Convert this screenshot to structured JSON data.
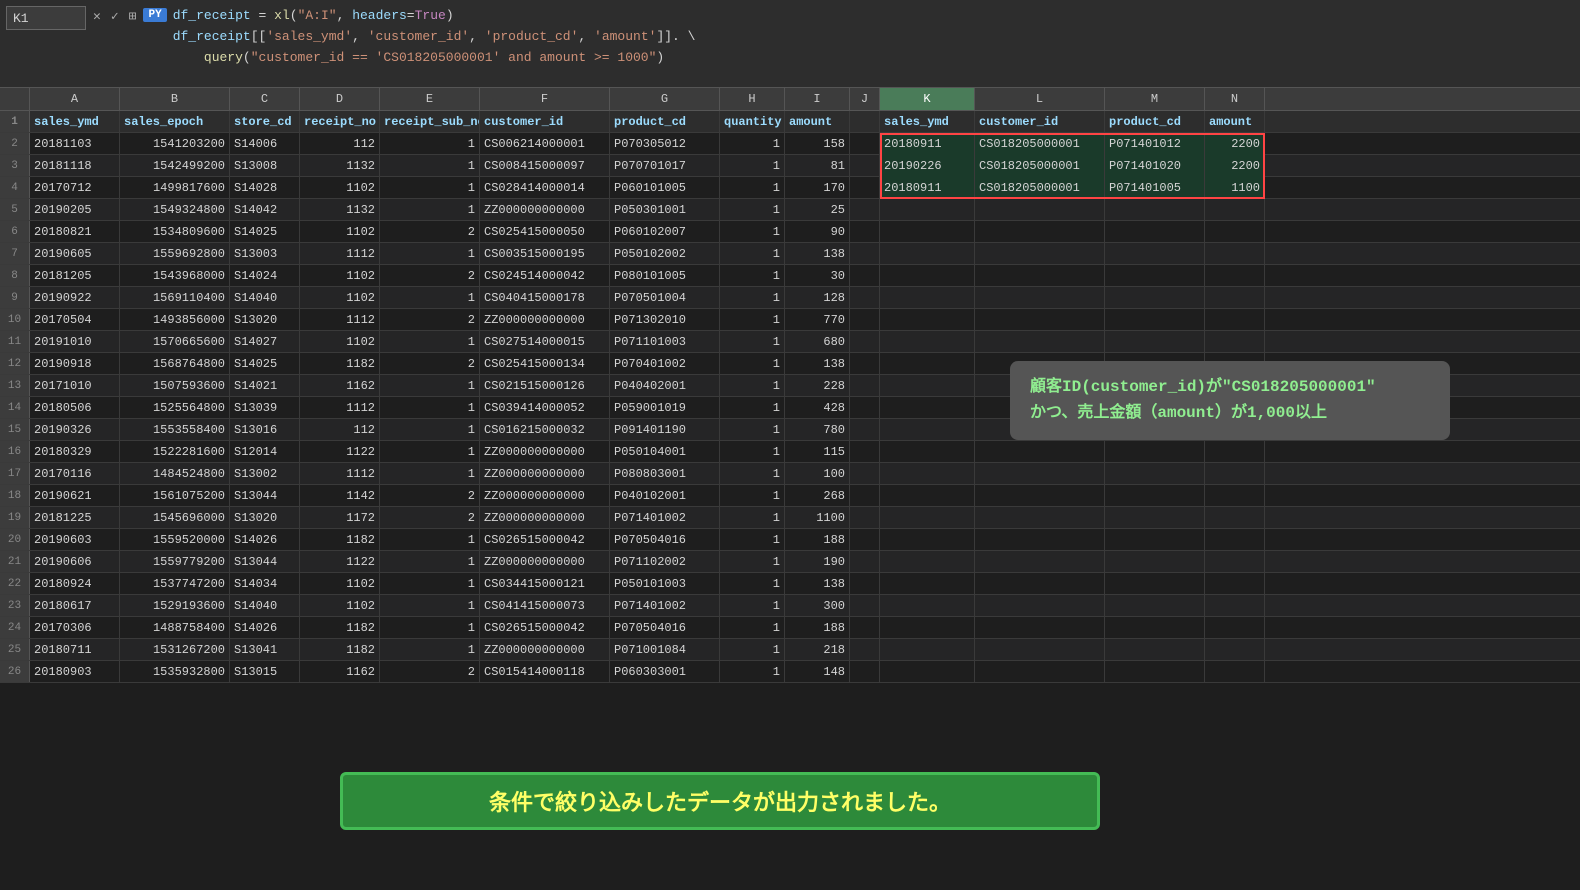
{
  "formula_bar": {
    "cell_ref": "K1",
    "py_badge": "PY",
    "line1": "df_receipt = xl(\"A:I\", headers=True)",
    "line2": "df_receipt[['sales_ymd', 'customer_id', 'product_cd', 'amount']].",
    "line3": "query(\"customer_id == 'CS018205000001' and amount >= 1000\")"
  },
  "columns": {
    "row_header": "",
    "cols": [
      "A",
      "B",
      "C",
      "D",
      "E",
      "F",
      "G",
      "H",
      "I",
      "J",
      "K",
      "L",
      "M",
      "N"
    ]
  },
  "header_row": {
    "row_num": "1",
    "cells": [
      "sales_ymd",
      "sales_epoch",
      "store_cd",
      "receipt_no",
      "receipt_sub_no",
      "customer_id",
      "product_cd",
      "quantity",
      "amount",
      "",
      "sales_ymd",
      "customer_id",
      "product_cd",
      "amount"
    ]
  },
  "data_rows": [
    {
      "n": "2200",
      "a": "20181103",
      "b": "1541203200",
      "c": "S14006",
      "d": "112",
      "e": "1",
      "f": "CS006214000001",
      "g": "P070305012",
      "h": "1",
      "i": "158",
      "j": "",
      "k": "20180911",
      "l": "CS018205000001",
      "m": "P071401012"
    },
    {
      "n": "2200",
      "a": "20181118",
      "b": "1542499200",
      "c": "S13008",
      "d": "1132",
      "e": "1",
      "f": "CS008415000097",
      "g": "P070701017",
      "h": "1",
      "i": "81",
      "j": "",
      "k": "20190226",
      "l": "CS018205000001",
      "m": "P071401020"
    },
    {
      "n": "1100",
      "a": "20170712",
      "b": "1499817600",
      "c": "S14028",
      "d": "1102",
      "e": "1",
      "f": "CS028414000014",
      "g": "P060101005",
      "h": "1",
      "i": "170",
      "j": "",
      "k": "20180911",
      "l": "CS018205000001",
      "m": "P071401005"
    },
    {
      "n": "",
      "a": "20190205",
      "b": "1549324800",
      "c": "S14042",
      "d": "1132",
      "e": "1",
      "f": "ZZ000000000000",
      "g": "P050301001",
      "h": "1",
      "i": "25",
      "j": "",
      "k": "",
      "l": "",
      "m": ""
    },
    {
      "n": "",
      "a": "20180821",
      "b": "1534809600",
      "c": "S14025",
      "d": "1102",
      "e": "2",
      "f": "CS025415000050",
      "g": "P060102007",
      "h": "1",
      "i": "90",
      "j": "",
      "k": "",
      "l": "",
      "m": ""
    },
    {
      "n": "",
      "a": "20190605",
      "b": "1559692800",
      "c": "S13003",
      "d": "1112",
      "e": "1",
      "f": "CS003515000195",
      "g": "P050102002",
      "h": "1",
      "i": "138",
      "j": "",
      "k": "",
      "l": "",
      "m": ""
    },
    {
      "n": "",
      "a": "20181205",
      "b": "1543968000",
      "c": "S14024",
      "d": "1102",
      "e": "2",
      "f": "CS024514000042",
      "g": "P080101005",
      "h": "1",
      "i": "30",
      "j": "",
      "k": "",
      "l": "",
      "m": ""
    },
    {
      "n": "",
      "a": "20190922",
      "b": "1569110400",
      "c": "S14040",
      "d": "1102",
      "e": "1",
      "f": "CS040415000178",
      "g": "P070501004",
      "h": "1",
      "i": "128",
      "j": "",
      "k": "",
      "l": "",
      "m": ""
    },
    {
      "n": "",
      "a": "20170504",
      "b": "1493856000",
      "c": "S13020",
      "d": "1112",
      "e": "2",
      "f": "ZZ000000000000",
      "g": "P071302010",
      "h": "1",
      "i": "770",
      "j": "",
      "k": "",
      "l": "",
      "m": ""
    },
    {
      "n": "",
      "a": "20191010",
      "b": "1570665600",
      "c": "S14027",
      "d": "1102",
      "e": "1",
      "f": "CS027514000015",
      "g": "P071101003",
      "h": "1",
      "i": "680",
      "j": "",
      "k": "",
      "l": "",
      "m": ""
    },
    {
      "n": "",
      "a": "20190918",
      "b": "1568764800",
      "c": "S14025",
      "d": "1182",
      "e": "2",
      "f": "CS025415000134",
      "g": "P070401002",
      "h": "1",
      "i": "138",
      "j": "",
      "k": "",
      "l": "",
      "m": ""
    },
    {
      "n": "",
      "a": "20171010",
      "b": "1507593600",
      "c": "S14021",
      "d": "1162",
      "e": "1",
      "f": "CS021515000126",
      "g": "P040402001",
      "h": "1",
      "i": "228",
      "j": "",
      "k": "",
      "l": "",
      "m": ""
    },
    {
      "n": "",
      "a": "20180506",
      "b": "1525564800",
      "c": "S13039",
      "d": "1112",
      "e": "1",
      "f": "CS039414000052",
      "g": "P059001019",
      "h": "1",
      "i": "428",
      "j": "",
      "k": "",
      "l": "",
      "m": ""
    },
    {
      "n": "",
      "a": "20190326",
      "b": "1553558400",
      "c": "S13016",
      "d": "112",
      "e": "1",
      "f": "CS016215000032",
      "g": "P091401190",
      "h": "1",
      "i": "780",
      "j": "",
      "k": "",
      "l": "",
      "m": ""
    },
    {
      "n": "",
      "a": "20180329",
      "b": "1522281600",
      "c": "S12014",
      "d": "1122",
      "e": "1",
      "f": "ZZ000000000000",
      "g": "P050104001",
      "h": "1",
      "i": "115",
      "j": "",
      "k": "",
      "l": "",
      "m": ""
    },
    {
      "n": "",
      "a": "20170116",
      "b": "1484524800",
      "c": "S13002",
      "d": "1112",
      "e": "1",
      "f": "ZZ000000000000",
      "g": "P080803001",
      "h": "1",
      "i": "100",
      "j": "",
      "k": "",
      "l": "",
      "m": ""
    },
    {
      "n": "",
      "a": "20190621",
      "b": "1561075200",
      "c": "S13044",
      "d": "1142",
      "e": "2",
      "f": "ZZ000000000000",
      "g": "P040102001",
      "h": "1",
      "i": "268",
      "j": "",
      "k": "",
      "l": "",
      "m": ""
    },
    {
      "n": "",
      "a": "20181225",
      "b": "1545696000",
      "c": "S13020",
      "d": "1172",
      "e": "2",
      "f": "ZZ000000000000",
      "g": "P071401002",
      "h": "1",
      "i": "1100",
      "j": "",
      "k": "",
      "l": "",
      "m": ""
    },
    {
      "n": "",
      "a": "20190603",
      "b": "1559520000",
      "c": "S14026",
      "d": "1182",
      "e": "1",
      "f": "CS026515000042",
      "g": "P070504016",
      "h": "1",
      "i": "188",
      "j": "",
      "k": "",
      "l": "",
      "m": ""
    },
    {
      "n": "",
      "a": "20190606",
      "b": "1559779200",
      "c": "S13044",
      "d": "1122",
      "e": "1",
      "f": "ZZ000000000000",
      "g": "P071102002",
      "h": "1",
      "i": "190",
      "j": "",
      "k": "",
      "l": "",
      "m": ""
    },
    {
      "n": "",
      "a": "20180924",
      "b": "1537747200",
      "c": "S14034",
      "d": "1102",
      "e": "1",
      "f": "CS034415000121",
      "g": "P050101003",
      "h": "1",
      "i": "138",
      "j": "",
      "k": "",
      "l": "",
      "m": ""
    },
    {
      "n": "",
      "a": "20180617",
      "b": "1529193600",
      "c": "S14040",
      "d": "1102",
      "e": "1",
      "f": "CS041415000073",
      "g": "P071401002",
      "h": "1",
      "i": "300",
      "j": "",
      "k": "",
      "l": "",
      "m": ""
    },
    {
      "n": "",
      "a": "20170306",
      "b": "1488758400",
      "c": "S14026",
      "d": "1182",
      "e": "1",
      "f": "CS026515000042",
      "g": "P070504016",
      "h": "1",
      "i": "188",
      "j": "",
      "k": "",
      "l": "",
      "m": ""
    },
    {
      "n": "",
      "a": "20180711",
      "b": "1531267200",
      "c": "S13041",
      "d": "1182",
      "e": "1",
      "f": "ZZ000000000000",
      "g": "P071001084",
      "h": "1",
      "i": "218",
      "j": "",
      "k": "",
      "l": "",
      "m": ""
    },
    {
      "n": "",
      "a": "20180903",
      "b": "1535932800",
      "c": "S13015",
      "d": "1162",
      "e": "2",
      "f": "CS015414000118",
      "g": "P060303001",
      "h": "1",
      "i": "148",
      "j": "",
      "k": "",
      "l": "",
      "m": ""
    }
  ],
  "tooltip": {
    "line1": "顧客ID(customer_id)が\"CS018205000001\"",
    "line2": "かつ、売上金額（amount）が1,000以上"
  },
  "banner": {
    "text": "条件で絞り込みしたデータが出力されました。"
  }
}
